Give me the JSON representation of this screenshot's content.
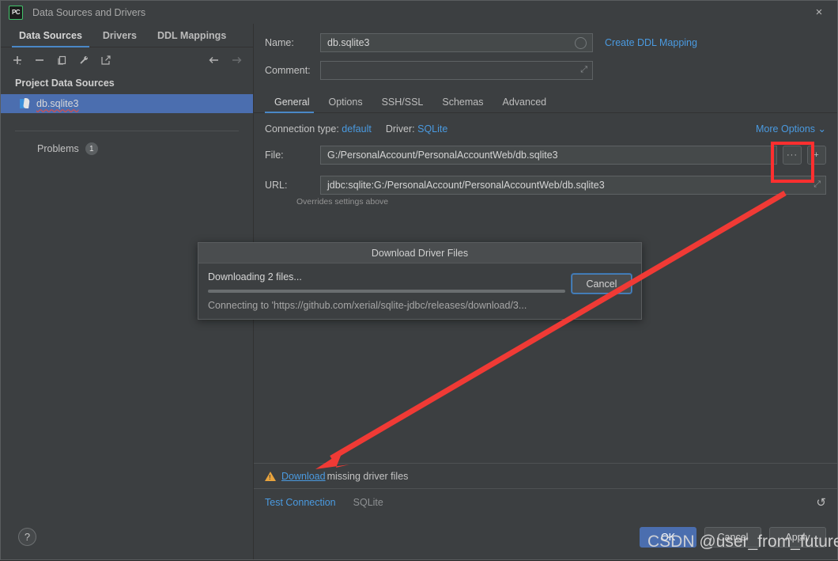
{
  "window": {
    "title": "Data Sources and Drivers",
    "logo_text": "PC",
    "close_icon": "×"
  },
  "sidebar": {
    "tabs": [
      {
        "label": "Data Sources",
        "active": true
      },
      {
        "label": "Drivers",
        "active": false
      },
      {
        "label": "DDL Mappings",
        "active": false
      }
    ],
    "toolbar": [
      {
        "name": "add-icon",
        "glyph": "+"
      },
      {
        "name": "remove-icon",
        "glyph": "−"
      },
      {
        "name": "copy-icon",
        "glyph": "❐"
      },
      {
        "name": "wrench-icon",
        "glyph": "🔧"
      },
      {
        "name": "open-external-icon",
        "glyph": "↗"
      },
      {
        "name": "back-icon",
        "glyph": "←"
      },
      {
        "name": "forward-icon",
        "glyph": "→"
      }
    ],
    "section_title": "Project Data Sources",
    "items": [
      {
        "label": "db.sqlite3",
        "selected": true,
        "icon": "sqlite-icon"
      }
    ],
    "problems": {
      "label": "Problems",
      "count": "1"
    },
    "help_glyph": "?"
  },
  "form": {
    "name_label": "Name:",
    "name_value": "db.sqlite3",
    "comment_label": "Comment:",
    "comment_value": "",
    "create_ddl_mapping": "Create DDL Mapping",
    "tabs": [
      {
        "label": "General",
        "active": true
      },
      {
        "label": "Options",
        "active": false
      },
      {
        "label": "SSH/SSL",
        "active": false
      },
      {
        "label": "Schemas",
        "active": false
      },
      {
        "label": "Advanced",
        "active": false
      }
    ],
    "connection_type_label": "Connection type:",
    "connection_type_value": "default",
    "driver_label": "Driver:",
    "driver_value": "SQLite",
    "more_options": "More Options ⌄",
    "file_label": "File:",
    "file_value": "G:/PersonalAccount/PersonalAccountWeb/db.sqlite3",
    "browse_glyph": "···",
    "add_glyph": "+",
    "url_label": "URL:",
    "url_value": "jdbc:sqlite:G:/PersonalAccount/PersonalAccountWeb/db.sqlite3",
    "url_expand_glyph": "⤢",
    "overrides_note": "Overrides settings above"
  },
  "warning": {
    "link_text": "Download",
    "rest_text": " missing driver files"
  },
  "status_bar": {
    "test_connection": "Test Connection",
    "driver_name": "SQLite",
    "refresh_glyph": "↺"
  },
  "buttons": {
    "ok": "OK",
    "cancel": "Cancel",
    "apply": "Apply"
  },
  "download_dialog": {
    "title": "Download Driver Files",
    "status": "Downloading 2 files...",
    "detail": "Connecting to 'https://github.com/xerial/sqlite-jdbc/releases/download/3...",
    "cancel": "Cancel"
  },
  "annotation": {
    "watermark": "CSDN @user_from_future",
    "highlight_color": "#ff2f2f",
    "arrow_color": "#f03a35"
  },
  "colors": {
    "accent_blue": "#4a9ae0",
    "selection_blue": "#4b6eaf",
    "panel_bg": "#3c3f41",
    "input_bg": "#45494a"
  }
}
